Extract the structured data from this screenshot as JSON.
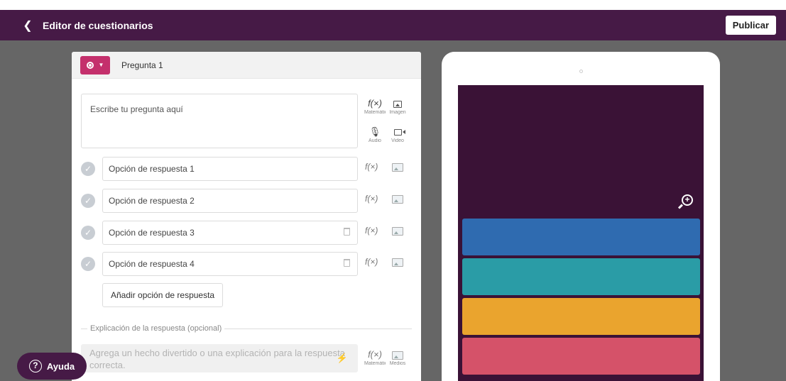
{
  "header": {
    "back_icon": "chevron-left-icon",
    "title": "Editor de cuestionarios",
    "publish_label": "Publicar",
    "background_color": "#461a46"
  },
  "editor": {
    "question_type_icon": "radio-button-icon",
    "question_label": "Pregunta 1",
    "question_placeholder": "Escribe tu pregunta aquí",
    "tools": {
      "math_label": "Matemáticas",
      "image_label": "Imagen",
      "audio_label": "Audio",
      "video_label": "Video"
    },
    "options": [
      {
        "label": "Opción de respuesta 1"
      },
      {
        "label": "Opción de respuesta 2"
      },
      {
        "label": "Opción de respuesta 3"
      },
      {
        "label": "Opción de respuesta 4"
      }
    ],
    "add_option_label": "Añadir opción de respuesta",
    "explanation_label": "Explicación de la respuesta (opcional)",
    "explanation_placeholder": "Agrega un hecho divertido o una explicación para la respuesta correcta.",
    "explanation_tools": {
      "math_label": "Matemáticas",
      "media_label": "Medios"
    }
  },
  "preview": {
    "screen_color": "#3a1236",
    "answer_colors": [
      "#2f6bb0",
      "#2a9ca6",
      "#eaa42e",
      "#d55269"
    ],
    "zoom_icon": "zoom-in-icon"
  },
  "help": {
    "label": "Ayuda",
    "icon": "question-circle-icon"
  },
  "fx_symbol": "f(×)"
}
